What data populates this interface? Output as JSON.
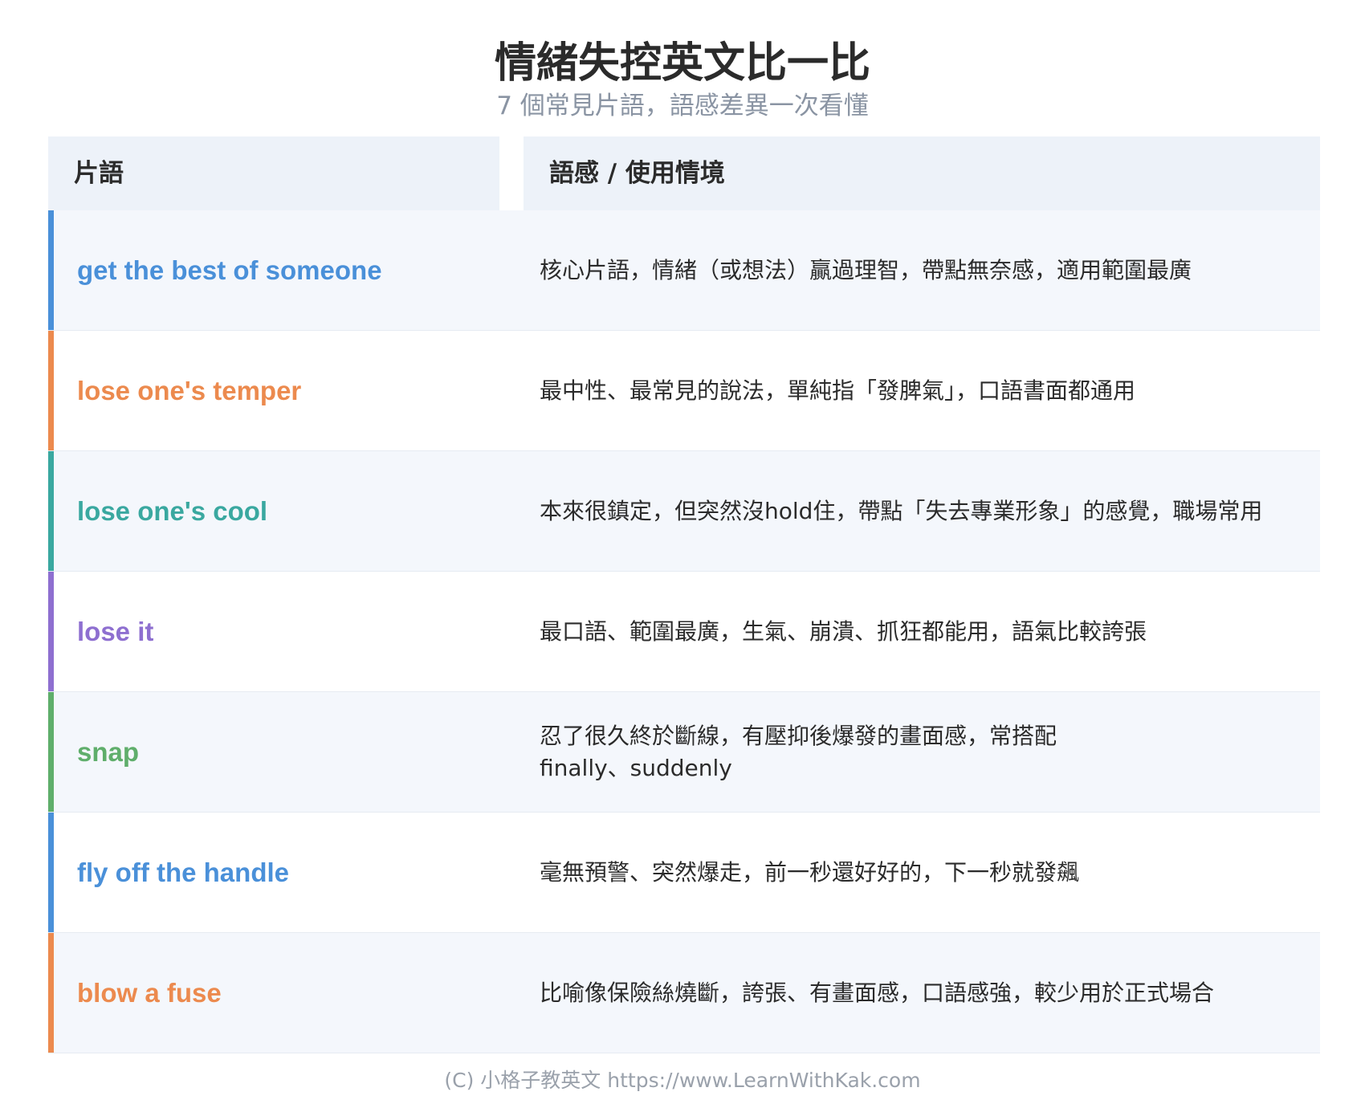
{
  "title": "情緒失控英文比一比",
  "subtitle": "7 個常見片語，語感差異一次看懂",
  "table": {
    "headers": {
      "phrase": "片語",
      "nuance": "語感 / 使用情境"
    },
    "rows": [
      {
        "phrase": "get the best of someone",
        "color": "#4a90d9",
        "nuance_lines": [
          "核心片語，情緒（或想法）贏過理智，帶點無奈感，適用範圍最廣"
        ]
      },
      {
        "phrase": "lose one's temper",
        "color": "#ec8a4e",
        "nuance_lines": [
          "最中性、最常見的說法，單純指「發脾氣」，口語書面都通用"
        ]
      },
      {
        "phrase": "lose one's cool",
        "color": "#3aa8a0",
        "nuance_lines": [
          "本來很鎮定，但突然沒hold住，帶點「失去專業形象」的感覺，職場常用"
        ]
      },
      {
        "phrase": "lose it",
        "color": "#8e6fd0",
        "nuance_lines": [
          "最口語、範圍最廣，生氣、崩潰、抓狂都能用，語氣比較誇張"
        ]
      },
      {
        "phrase": "snap",
        "color": "#5fae6b",
        "nuance_lines": [
          "忍了很久終於斷線，有壓抑後爆發的畫面感，常搭配",
          "finally、suddenly"
        ]
      },
      {
        "phrase": "fly off the handle",
        "color": "#4a90d9",
        "nuance_lines": [
          "毫無預警、突然爆走，前一秒還好好的，下一秒就發飆"
        ]
      },
      {
        "phrase": "blow a fuse",
        "color": "#ec8a4e",
        "nuance_lines": [
          "比喻像保險絲燒斷，誇張、有畫面感，口語感強，較少用於正式場合"
        ]
      }
    ]
  },
  "footer": "(C) 小格子教英文 https://www.LearnWithKak.com"
}
